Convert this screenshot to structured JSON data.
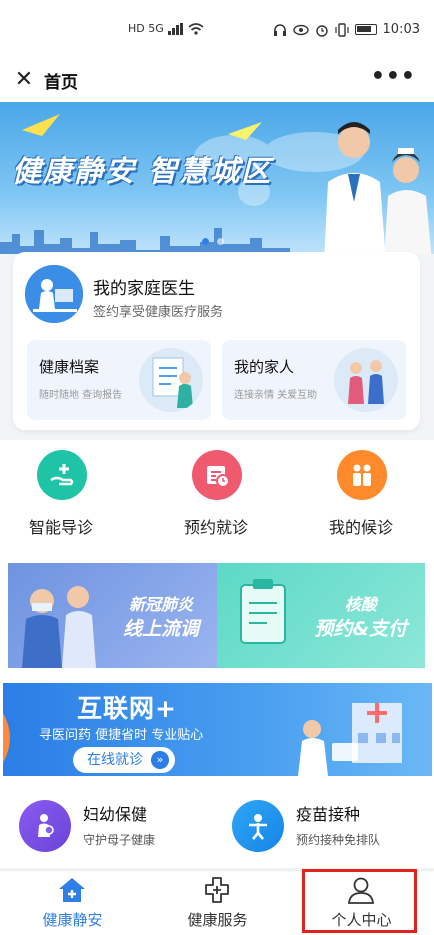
{
  "status": {
    "network": "HD 5G",
    "time": "10:03"
  },
  "titlebar": {
    "close_icon": "close-icon",
    "title": "首页",
    "more": "•••"
  },
  "banner": {
    "text": "健康静安 智慧城区",
    "active_slide": 1,
    "slide_count": 2
  },
  "doctor": {
    "title": "我的家庭医生",
    "subtitle": "签约享受健康医疗服务",
    "cards": [
      {
        "title": "健康档案",
        "subtitle": "随时随地 查询报告"
      },
      {
        "title": "我的家人",
        "subtitle": "连接亲情 关爱互助"
      }
    ]
  },
  "functions": [
    {
      "label": "智能导诊",
      "icon": "hand-plus-icon",
      "color": "#1fc3a6"
    },
    {
      "label": "预约就诊",
      "icon": "calendar-clock-icon",
      "color": "#f05a6f"
    },
    {
      "label": "我的候诊",
      "icon": "people-queue-icon",
      "color": "#ff8a2b"
    }
  ],
  "promos": [
    {
      "line1": "新冠肺炎",
      "line2": "线上流调"
    },
    {
      "line1": "核酸",
      "line2": "预约&支付"
    }
  ],
  "internet": {
    "title": "互联网+",
    "subtitle": "寻医问药 便捷省时 专业贴心",
    "button": "在线就诊",
    "button_icon": "double-chevron-right-icon"
  },
  "services": [
    {
      "title": "妇幼保健",
      "desc": "守护母子健康",
      "icon": "mother-baby-icon"
    },
    {
      "title": "疫苗接种",
      "desc": "预约接种免排队",
      "icon": "child-vaccine-icon"
    }
  ],
  "tabs": [
    {
      "label": "健康静安",
      "icon": "home-icon",
      "active": true
    },
    {
      "label": "健康服务",
      "icon": "medical-cross-icon",
      "active": false
    },
    {
      "label": "个人中心",
      "icon": "user-icon",
      "active": false
    }
  ],
  "colors": {
    "accent": "#2f7fe8",
    "highlight_box": "#e3211d"
  }
}
